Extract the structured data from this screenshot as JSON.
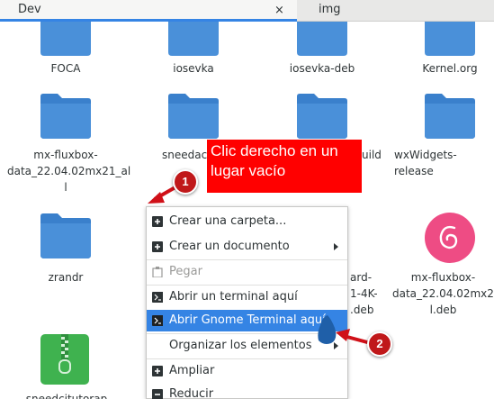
{
  "tabs": [
    {
      "label": "Dev",
      "active": true
    },
    {
      "label": "img",
      "active": false
    }
  ],
  "tab_close": "×",
  "files": [
    {
      "label": "FOCA",
      "icon": "folder-icon"
    },
    {
      "label": "iosevka",
      "icon": "folder-icon"
    },
    {
      "label": "iosevka-deb",
      "icon": "folder-icon"
    },
    {
      "label": "Kernel.org",
      "icon": "folder-icon"
    },
    {
      "label_lines": [
        "mx-fluxbox-",
        "data_22.04.02mx21_al",
        "l"
      ],
      "icon": "folder-icon"
    },
    {
      "label": "sneedac",
      "icon": "folder-icon"
    },
    {
      "label": "uild",
      "icon": "folder-icon"
    },
    {
      "label": "wxWidgets-release",
      "icon": "folder-icon"
    },
    {
      "label": "zrandr",
      "icon": "folder-icon"
    },
    {
      "label_lines": [
        "ard-",
        "1-4K-",
        ".deb"
      ],
      "icon": "hidden"
    },
    {
      "label_lines": [
        "mx-fluxbox-",
        "data_22.04.02mx21_al",
        "l.deb"
      ],
      "icon": "debian-package-icon"
    },
    {
      "label": "sneedcitutorap",
      "icon": "zip-archive-icon"
    }
  ],
  "context_menu": {
    "items": [
      {
        "label": "Crear una carpeta...",
        "icon": "add-folder-icon",
        "state": "normal"
      },
      {
        "label": "Crear un documento",
        "icon": "add-document-icon",
        "state": "normal",
        "submenu": true
      },
      {
        "label": "Pegar",
        "icon": "paste-icon",
        "state": "disabled"
      },
      {
        "label": "Abrir un terminal aquí",
        "icon": "terminal-icon",
        "state": "normal"
      },
      {
        "label": "Abrir Gnome Terminal aquí",
        "icon": "terminal-icon",
        "state": "highlighted"
      },
      {
        "label": "Organizar los elementos",
        "icon": "",
        "state": "normal",
        "submenu": true
      },
      {
        "label": "Ampliar",
        "icon": "zoom-in-icon",
        "state": "normal"
      },
      {
        "label": "Reducir",
        "icon": "zoom-out-icon",
        "state": "normal"
      }
    ]
  },
  "annotation": {
    "callout_line1": "Clic derecho en un",
    "callout_line2": "lugar vacío",
    "badge1": "1",
    "badge2": "2"
  },
  "colors": {
    "accent": "#3584e4",
    "folder": "#4a90d9",
    "annotation_red": "#ff0000",
    "badge_red": "#c0181a"
  }
}
